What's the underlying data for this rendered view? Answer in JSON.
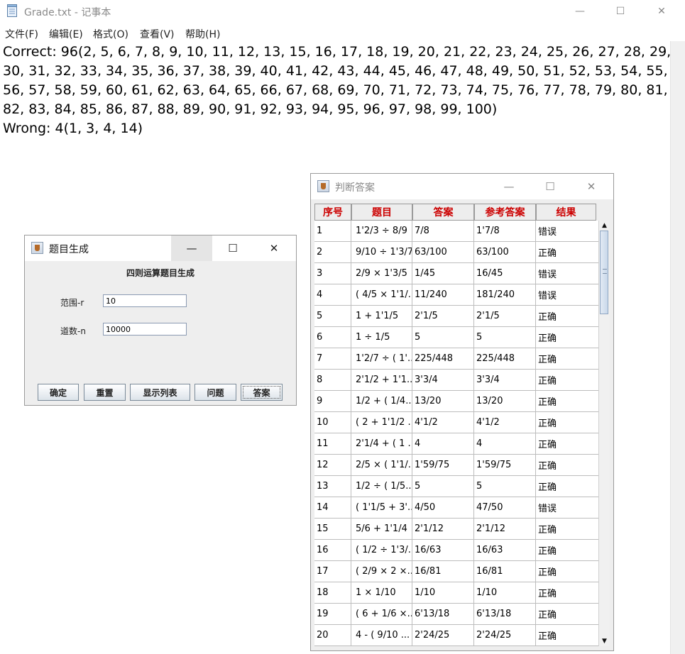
{
  "notepad": {
    "title": "Grade.txt - 记事本",
    "menu": [
      "文件(F)",
      "编辑(E)",
      "格式(O)",
      "查看(V)",
      "帮助(H)"
    ],
    "lines": [
      "Correct: 96(2, 5, 6, 7, 8, 9, 10, 11, 12, 13, 15, 16, 17, 18, 19, 20, 21, 22, 23, 24, 25, 26, 27, 28, 29,",
      "30, 31, 32, 33, 34, 35, 36, 37, 38, 39, 40, 41, 42, 43, 44, 45, 46, 47, 48, 49, 50, 51, 52, 53, 54, 55,",
      "56, 57, 58, 59, 60, 61, 62, 63, 64, 65, 66, 67, 68, 69, 70, 71, 72, 73, 74, 75, 76, 77, 78, 79, 80, 81,",
      "82, 83, 84, 85, 86, 87, 88, 89, 90, 91, 92, 93, 94, 95, 96, 97, 98, 99, 100)",
      "Wrong: 4(1, 3, 4, 14)"
    ],
    "controls": {
      "minimize": "—",
      "maximize": "☐",
      "close": "✕"
    }
  },
  "generator": {
    "title": "题目生成",
    "heading": "四则运算题目生成",
    "range_label": "范围-r",
    "range_value": "10",
    "count_label": "道数-n",
    "count_value": "10000",
    "buttons": [
      "确定",
      "重置",
      "显示列表",
      "问题",
      "答案"
    ],
    "controls": {
      "minimize": "—",
      "maximize": "☐",
      "close": "✕"
    }
  },
  "judge": {
    "title": "判断答案",
    "headers": [
      "序号",
      "题目",
      "答案",
      "参考答案",
      "结果"
    ],
    "rows": [
      [
        "1",
        "1'2/3 ÷ 8/9",
        "7/8",
        "1'7/8",
        "错误"
      ],
      [
        "2",
        "9/10 ÷ 1'3/7",
        "63/100",
        "63/100",
        "正确"
      ],
      [
        "3",
        "2/9 × 1'3/5",
        "1/45",
        "16/45",
        "错误"
      ],
      [
        "4",
        "( 4/5 × 1'1/...",
        "11/240",
        "181/240",
        "错误"
      ],
      [
        "5",
        "1 + 1'1/5",
        "2'1/5",
        "2'1/5",
        "正确"
      ],
      [
        "6",
        "1 ÷ 1/5",
        "5",
        "5",
        "正确"
      ],
      [
        "7",
        "1'2/7 ÷ ( 1'...",
        "225/448",
        "225/448",
        "正确"
      ],
      [
        "8",
        "2'1/2 + 1'1...",
        "3'3/4",
        "3'3/4",
        "正确"
      ],
      [
        "9",
        "1/2 + ( 1/4...",
        "13/20",
        "13/20",
        "正确"
      ],
      [
        "10",
        "( 2 + 1'1/2 ...",
        "4'1/2",
        "4'1/2",
        "正确"
      ],
      [
        "11",
        "2'1/4 + ( 1 ...",
        "4",
        "4",
        "正确"
      ],
      [
        "12",
        "2/5 × ( 1'1/...",
        "1'59/75",
        "1'59/75",
        "正确"
      ],
      [
        "13",
        "1/2 ÷ ( 1/5...",
        "5",
        "5",
        "正确"
      ],
      [
        "14",
        "( 1'1/5 + 3'...",
        "4/50",
        "47/50",
        "错误"
      ],
      [
        "15",
        "5/6 + 1'1/4",
        "2'1/12",
        "2'1/12",
        "正确"
      ],
      [
        "16",
        "( 1/2 ÷ 1'3/...",
        "16/63",
        "16/63",
        "正确"
      ],
      [
        "17",
        "( 2/9 × 2 ×...",
        "16/81",
        "16/81",
        "正确"
      ],
      [
        "18",
        "1 × 1/10",
        "1/10",
        "1/10",
        "正确"
      ],
      [
        "19",
        "( 6 + 1/6 ×...",
        "6'13/18",
        "6'13/18",
        "正确"
      ],
      [
        "20",
        "4 - ( 9/10 ...",
        "2'24/25",
        "2'24/25",
        "正确"
      ]
    ],
    "controls": {
      "minimize": "—",
      "maximize": "☐",
      "close": "✕"
    }
  }
}
